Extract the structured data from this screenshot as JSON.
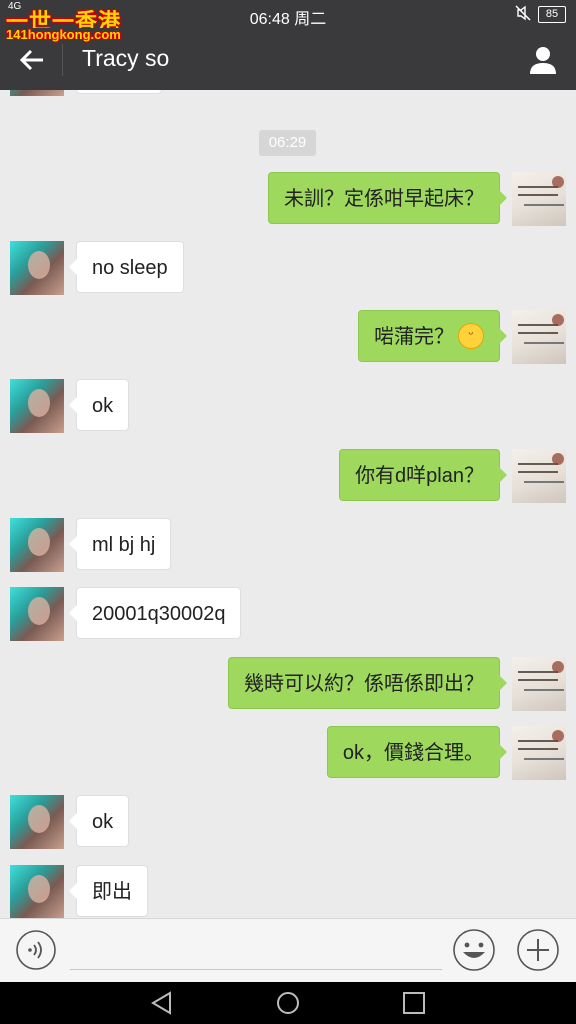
{
  "status_bar": {
    "network": "4G",
    "watermark_top": "一世一香港",
    "time": "06:48 周二",
    "battery": "85"
  },
  "header": {
    "watermark_url": "141hongkong.com",
    "title": "Tracy so"
  },
  "chat": {
    "timestamp": "06:29",
    "messages": [
      {
        "side": "out",
        "text": "未訓？定係咁早起床？"
      },
      {
        "side": "in",
        "text": "no sleep"
      },
      {
        "side": "out",
        "text": "啱蒲完？",
        "emoji": "grinning-face"
      },
      {
        "side": "in",
        "text": "ok"
      },
      {
        "side": "out",
        "text": "你有d咩plan？"
      },
      {
        "side": "in",
        "text": "ml bj hj"
      },
      {
        "side": "in",
        "text": "20001q30002q"
      },
      {
        "side": "out",
        "text": "幾時可以約？係唔係即出？"
      },
      {
        "side": "out",
        "text": "ok，價錢合理。"
      },
      {
        "side": "in",
        "text": "ok"
      },
      {
        "side": "in",
        "text": "即出"
      }
    ]
  },
  "input_bar": {
    "icons": [
      "voice-icon",
      "emoji-icon",
      "plus-icon"
    ]
  },
  "nav_bar": {
    "icons": [
      "back-triangle-icon",
      "home-circle-icon",
      "recents-square-icon"
    ]
  },
  "colors": {
    "outgoing_bubble": "#9ed95d",
    "incoming_bubble": "#ffffff",
    "bar": "#3a3a3c",
    "background": "#ebebeb"
  }
}
